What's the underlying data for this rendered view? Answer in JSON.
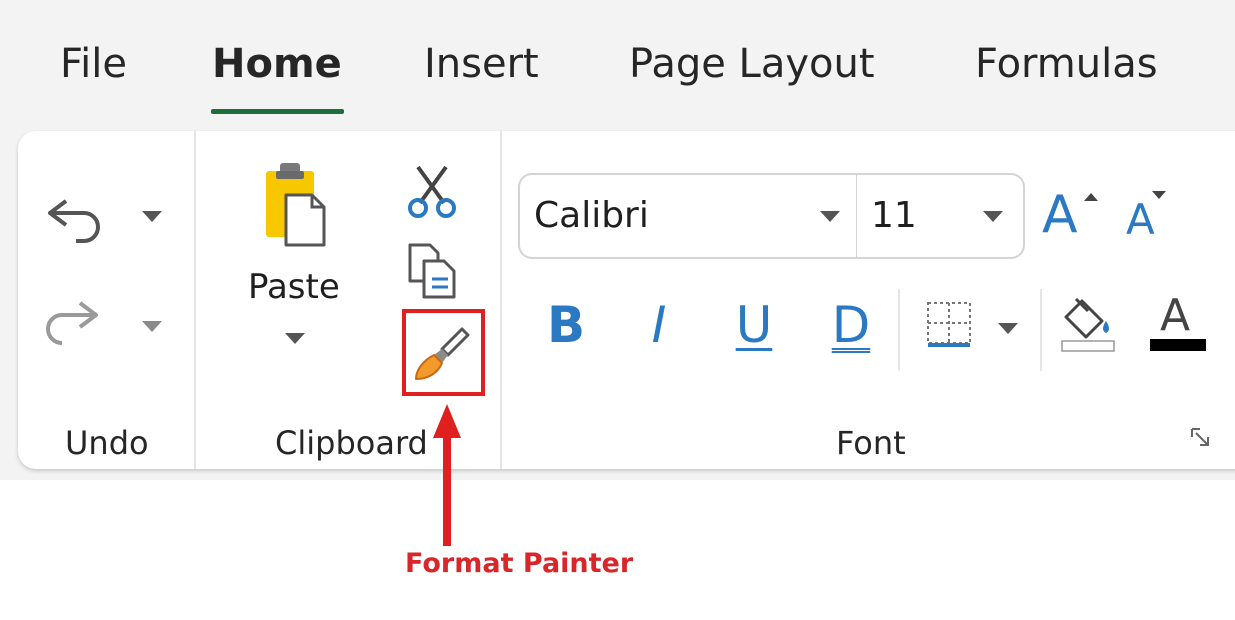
{
  "tabs": [
    {
      "label": "File"
    },
    {
      "label": "Home",
      "active": true
    },
    {
      "label": "Insert"
    },
    {
      "label": "Page Layout"
    },
    {
      "label": "Formulas"
    }
  ],
  "groups": {
    "undo": {
      "label": "Undo"
    },
    "clipboard": {
      "label": "Clipboard",
      "paste_label": "Paste"
    },
    "font": {
      "label": "Font",
      "font_name": "Calibri",
      "font_size": "11",
      "bold": "B",
      "italic": "I",
      "underline": "U",
      "double_underline": "D",
      "grow_font": "A",
      "shrink_font": "A",
      "font_color": "A"
    }
  },
  "icons": {
    "undo": "undo-icon",
    "redo": "redo-icon",
    "paste": "clipboard-icon",
    "cut": "scissors-icon",
    "copy": "copy-icon",
    "format_painter": "paintbrush-icon",
    "borders": "borders-icon",
    "fill": "fill-color-icon",
    "launcher": "dialog-launcher-icon"
  },
  "annotation": {
    "label": "Format Painter"
  },
  "colors": {
    "accent_green": "#1e6e3c",
    "accent_blue": "#2b79c2",
    "annotation_red": "#e01f1f",
    "clipboard_yellow": "#f7c700",
    "brush_orange": "#f39a2c",
    "font_color_bar": "#000000"
  }
}
